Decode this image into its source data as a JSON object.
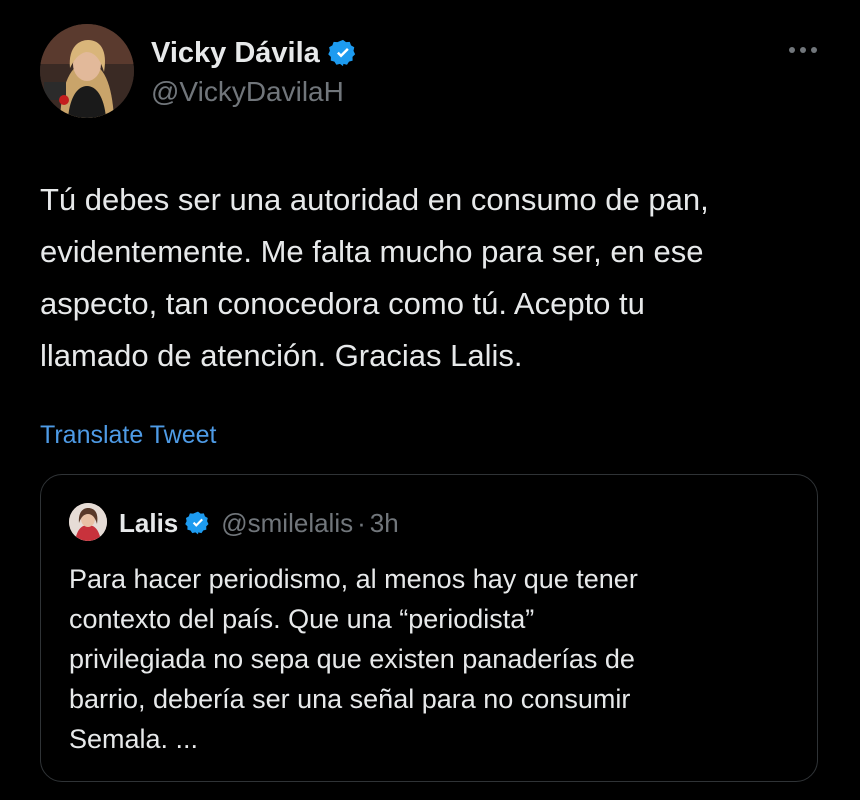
{
  "tweet": {
    "author": {
      "name": "Vicky Dávila",
      "handle": "@VickyDavilaH",
      "verified": true
    },
    "text_lines": [
      "Tú debes ser una autoridad en consumo de pan,",
      "evidentemente. Me falta mucho para ser, en ese",
      "aspecto, tan conocedora como tú. Acepto tu",
      "llamado de atención. Gracias Lalis."
    ],
    "translate_label": "Translate Tweet",
    "more_icon": "more-horizontal-icon"
  },
  "quote": {
    "author": {
      "name": "Lalis",
      "handle": "@smilelalis",
      "separator": "·",
      "time": "3h",
      "verified": true
    },
    "text_lines": [
      "Para hacer periodismo, al menos hay que tener",
      "contexto del país. Que una “periodista”",
      "privilegiada no sepa que existen panaderías de",
      "barrio, debería ser una señal para no consumir",
      "Semala. ..."
    ]
  },
  "colors": {
    "background": "#000000",
    "text": "#e7e9ea",
    "secondary": "#71767b",
    "link": "#4e9be6",
    "verified": "#1d9bf0",
    "border": "#2f3336"
  }
}
